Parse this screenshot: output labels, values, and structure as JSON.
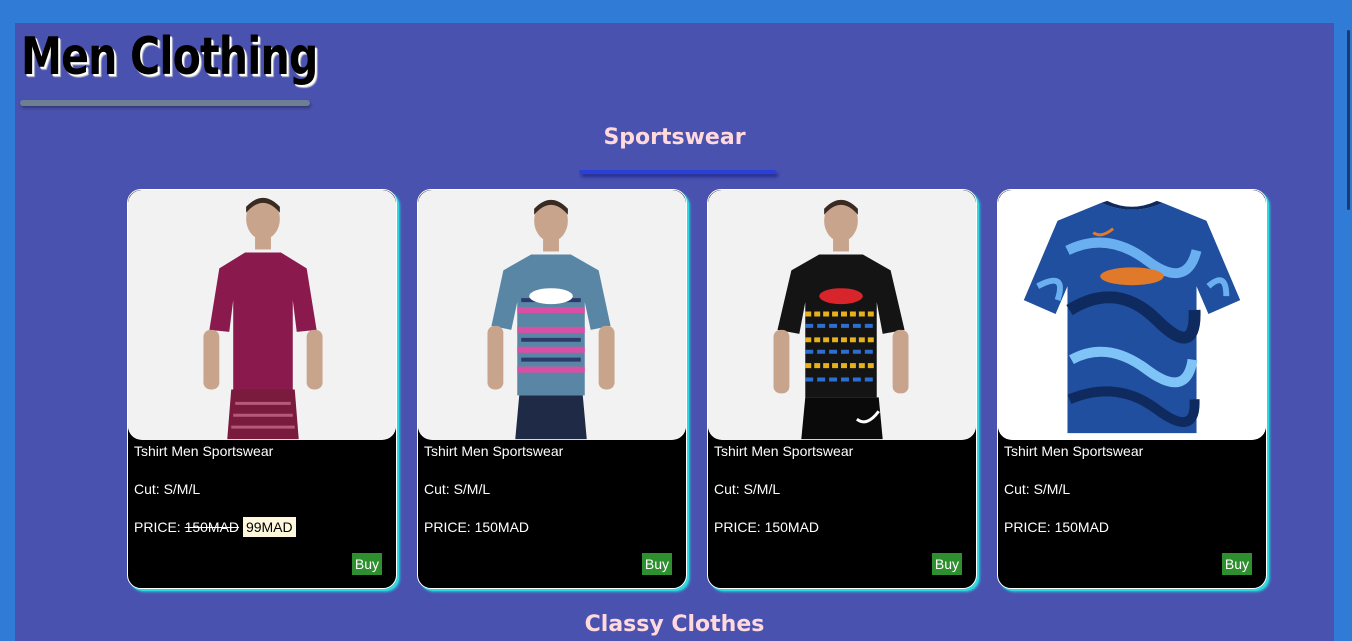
{
  "page": {
    "title": "Men Clothing"
  },
  "sections": [
    {
      "title": "Sportswear"
    },
    {
      "title": "Classy Clothes"
    }
  ],
  "products": [
    {
      "name": "Tshirt Men Sportswear",
      "cut": "Cut: S/M/L",
      "price_label": "PRICE: ",
      "old_price": "150MAD",
      "new_price": "99MAD",
      "buy_label": "Buy",
      "image_icon": "maroon-tshirt-model-photo"
    },
    {
      "name": "Tshirt Men Sportswear",
      "cut": "Cut: S/M/L",
      "price_label": "PRICE: 150MAD",
      "buy_label": "Buy",
      "image_icon": "pink-blue-jersey-model-photo"
    },
    {
      "name": "Tshirt Men Sportswear",
      "cut": "Cut: S/M/L",
      "price_label": "PRICE: 150MAD",
      "buy_label": "Buy",
      "image_icon": "black-jersey-model-photo"
    },
    {
      "name": "Tshirt Men Sportswear",
      "cut": "Cut: S/M/L",
      "price_label": "PRICE: 150MAD",
      "buy_label": "Buy",
      "image_icon": "blue-camo-jersey-photo"
    }
  ],
  "colors": {
    "page_background": "#2f7bd6",
    "panel_background": "#4a52b0",
    "section_title": "#ffd9dc",
    "card_background": "#000000",
    "card_glow": "#2fd7e0",
    "buy_button": "#2e8f2e",
    "sale_price_highlight": "#fff8dc"
  }
}
